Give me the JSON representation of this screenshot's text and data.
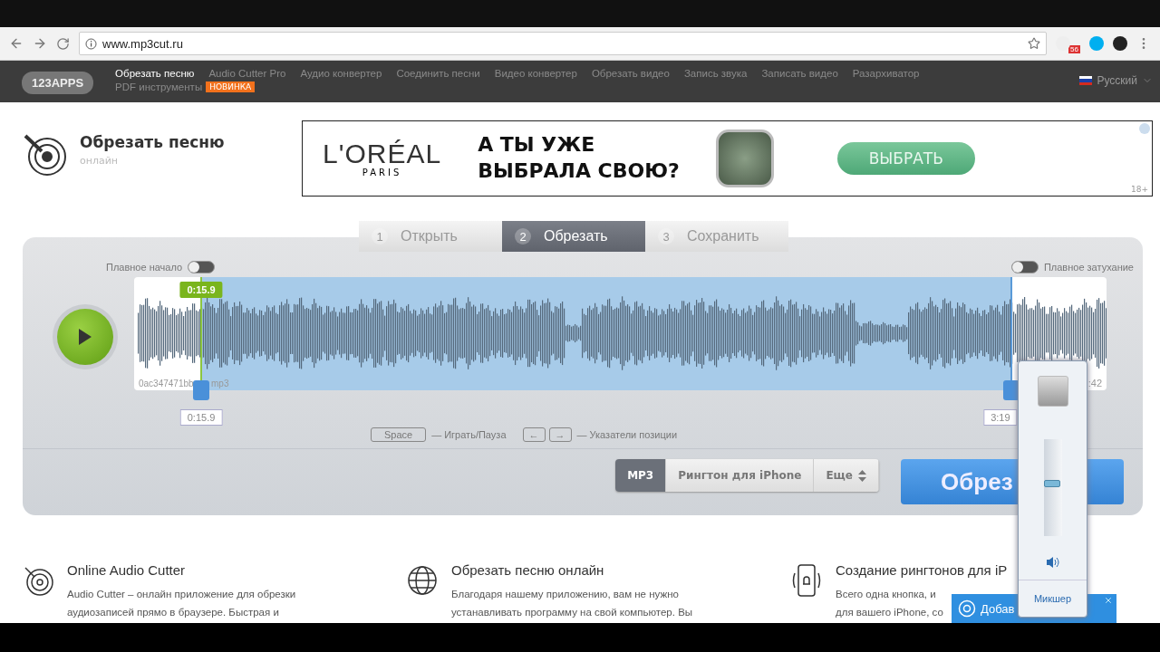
{
  "browser": {
    "url": "www.mp3cut.ru",
    "extension_badge": "56"
  },
  "site_nav": {
    "logo": "123APPS",
    "items": [
      {
        "label": "Обрезать песню",
        "selected": true
      },
      {
        "label": "Audio Cutter Pro",
        "selected": false
      },
      {
        "label": "Аудио конвертер",
        "selected": false
      },
      {
        "label": "Соединить песни",
        "selected": false
      },
      {
        "label": "Видео конвертер",
        "selected": false
      },
      {
        "label": "Обрезать видео",
        "selected": false
      },
      {
        "label": "Запись звука",
        "selected": false
      },
      {
        "label": "Записать видео",
        "selected": false
      },
      {
        "label": "Разархиватор",
        "selected": false
      },
      {
        "label": "PDF инструменты",
        "selected": false
      }
    ],
    "new_badge": "НОВИНКА",
    "language": "Русский"
  },
  "header": {
    "title": "Обрезать песню",
    "subtitle": "онлайн"
  },
  "ad": {
    "brand": "L'ORÉAL",
    "brand_sub": "PARIS",
    "headline": [
      "А ТЫ УЖЕ",
      "ВЫБРАЛА СВОЮ?"
    ],
    "button": "ВЫБРАТЬ",
    "age": "18+"
  },
  "steps": [
    {
      "number": "1",
      "label": "Открыть",
      "selected": false
    },
    {
      "number": "2",
      "label": "Обрезать",
      "selected": true
    },
    {
      "number": "3",
      "label": "Сохранить",
      "selected": false
    }
  ],
  "editor": {
    "fade_in": {
      "label": "Плавное начало",
      "on": false
    },
    "fade_out": {
      "label": "Плавное затухание",
      "on": false
    },
    "start_handle": {
      "level": 0.069,
      "time": "0:15.9",
      "top_time": "0:15.9"
    },
    "end_handle": {
      "level": 0.902,
      "time": "3:19"
    },
    "filename": [
      "0ac347471bb",
      "mp3"
    ],
    "duration": ":42",
    "hints": [
      {
        "keys": [
          "Space"
        ],
        "text": "— Играть/Пауза"
      },
      {
        "keys": [
          "←",
          "→"
        ],
        "text": "— Указатели позиции"
      }
    ],
    "formats": [
      {
        "label": "MP3",
        "selected": true
      },
      {
        "label": "Рингтон для iPhone",
        "selected": false
      },
      {
        "label": "Еще",
        "selected": false
      }
    ],
    "cut_button": "Обрез"
  },
  "features": [
    {
      "kind": "disc",
      "title": "Online Audio Cutter",
      "text": [
        "Audio Cutter – онлайн приложение для обрезки",
        "аудиозаписей прямо в браузере. Быстрая и"
      ]
    },
    {
      "kind": "globe",
      "title": "Обрезать песню онлайн",
      "text": [
        "Благодаря нашему приложению, вам не нужно",
        "устанавливать программу на свой компьютер. Вы"
      ]
    },
    {
      "kind": "phone",
      "title": "Создание рингтонов для iP",
      "text": [
        "Всего одна кнопка, и",
        "для вашего iPhone, со"
      ]
    }
  ],
  "volume_popup": {
    "level": 0.54,
    "link": "Микшер"
  },
  "notification": {
    "text": "Добав"
  }
}
